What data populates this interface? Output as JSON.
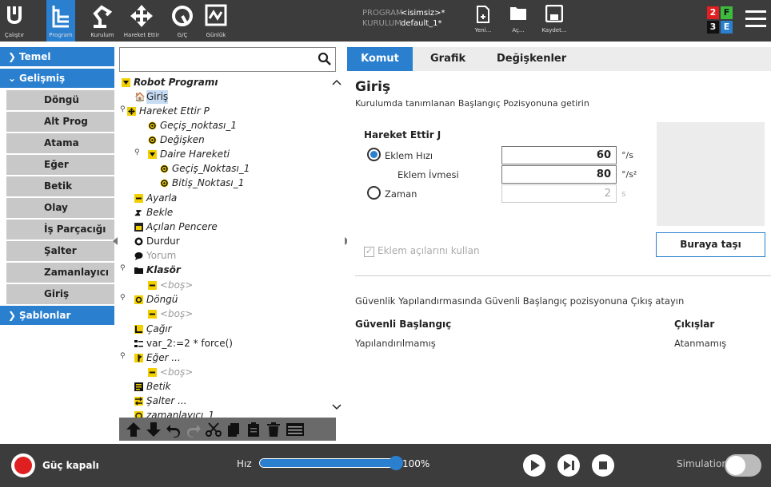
{
  "header": {
    "nav": [
      {
        "label": "Çalıştır",
        "icon": "ur-logo-icon"
      },
      {
        "label": "Program",
        "icon": "program-icon",
        "active": true
      },
      {
        "label": "Kurulum",
        "icon": "robot-arm-icon"
      },
      {
        "label": "Hareket Ettir",
        "icon": "move-cross-icon"
      },
      {
        "label": "G/Ç",
        "icon": "io-gauge-icon"
      },
      {
        "label": "Günlük",
        "icon": "log-chart-icon"
      }
    ],
    "program_key": "PROGRAM",
    "program_value": "<isimsiz>*",
    "install_key": "KURULUM",
    "install_value": "default_1*",
    "file_buttons": [
      "Yeni...",
      "Aç...",
      "Kaydet..."
    ],
    "status": [
      "2",
      "F",
      "3",
      "E"
    ],
    "colors": {
      "bar": "#3c3c3c",
      "accent": "#2a7fcf",
      "status_red": "#e02020",
      "status_green": "#3dbb3d",
      "status_blue": "#2a7fcf"
    }
  },
  "leftnav": {
    "temel": "Temel",
    "gelismis": "Gelişmiş",
    "items": [
      "Döngü",
      "Alt Prog",
      "Atama",
      "Eğer",
      "Betik",
      "Olay",
      "İş Parçacığı",
      "Şalter",
      "Zamanlayıcı",
      "Giriş"
    ],
    "sablonlar": "Şablonlar"
  },
  "search": {
    "value": ""
  },
  "tree": [
    "Robot Programı",
    "Giriş",
    "Hareket Ettir P",
    "Geçiş_noktası_1",
    "Değişken",
    "Daire Hareketi",
    "Geçiş_Noktası_1",
    "Bitiş_Noktası_1",
    "Ayarla",
    "Bekle",
    "Açılan Pencere",
    "Durdur",
    "Yorum",
    "Klasör",
    "<boş>",
    "Döngü",
    "<boş>",
    "Çağır",
    "var_2:=2 * force()",
    "Eğer ...",
    "<boş>",
    "Betik",
    "Şalter ...",
    "zamanlayıcı_1"
  ],
  "tabs": [
    "Komut",
    "Grafik",
    "Değişkenler"
  ],
  "command": {
    "title": "Giriş",
    "description": "Kurulumda tanımlanan Başlangıç Pozisyonuna getirin",
    "move_title": "Hareket Ettir J",
    "joint_speed_label": "Eklem Hızı",
    "joint_speed_value": "60",
    "joint_speed_unit": "°/s",
    "joint_accel_label": "Eklem İvmesi",
    "joint_accel_value": "80",
    "joint_accel_unit": "°/s²",
    "time_label": "Zaman",
    "time_value": "2",
    "time_unit": "s",
    "move_here": "Buraya taşı",
    "use_joint_angles": "Eklem açılarını kullan",
    "safe_desc": "Güvenlik Yapılandırmasında Güvenli Başlangıç pozisyonuna Çıkış atayın",
    "safe_head": "Güvenli Başlangıç",
    "outputs_head": "Çıkışlar",
    "safe_val": "Yapılandırılmamış",
    "outputs_val": "Atanmamış"
  },
  "footer": {
    "power": "Güç kapalı",
    "speed_label": "Hız",
    "speed_value": "100%",
    "speed_fraction": 1.0,
    "simulation": "Simulation"
  }
}
